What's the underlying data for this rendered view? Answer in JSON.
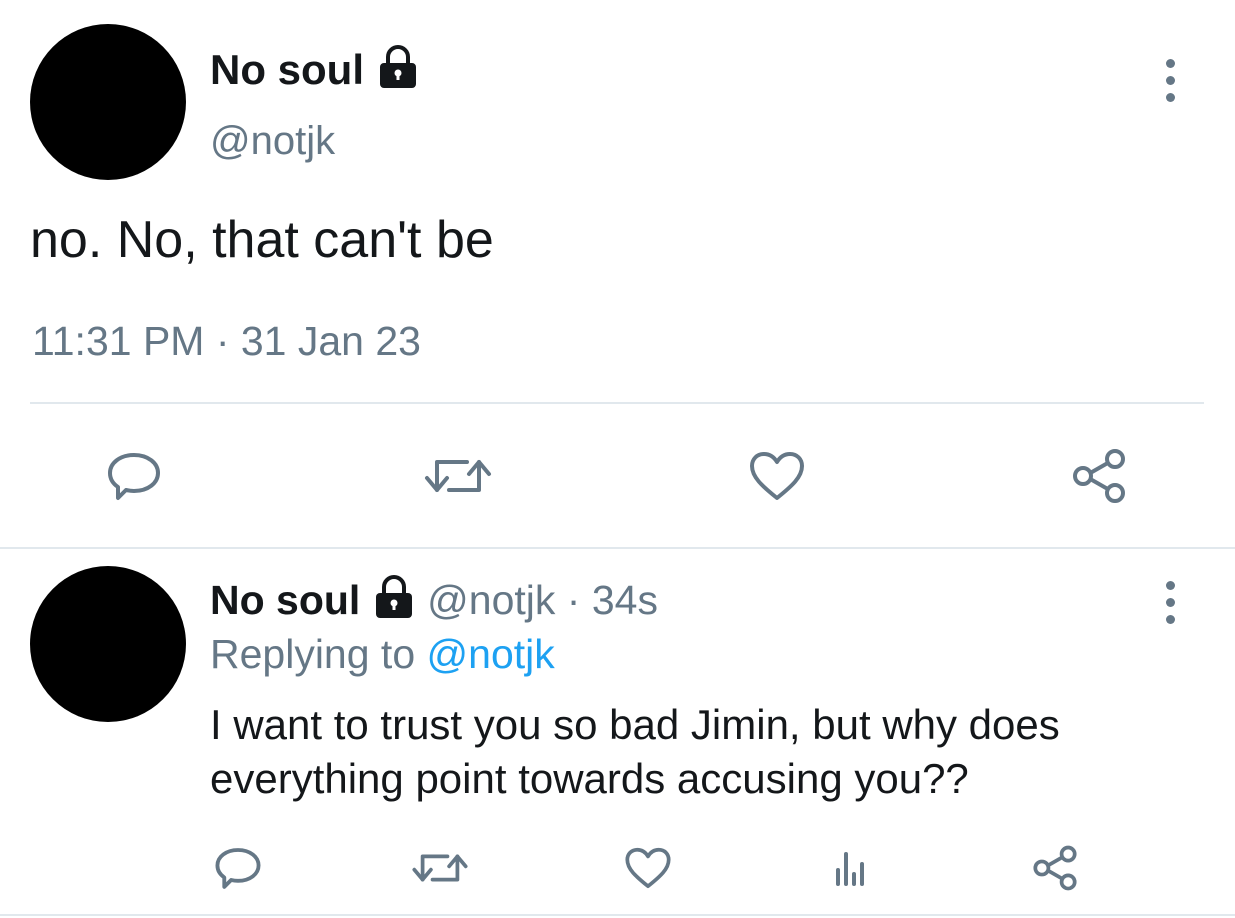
{
  "main_tweet": {
    "display_name": "No soul",
    "handle": "@notjk",
    "text": "no. No, that can't be",
    "timestamp": "11:31 PM · 31 Jan 23",
    "actions": [
      "reply-icon",
      "retweet-icon",
      "like-icon",
      "share-icon"
    ]
  },
  "reply_tweet": {
    "display_name": "No soul",
    "handle": "@notjk",
    "separator": "·",
    "age": "34s",
    "replying_prefix": "Replying to",
    "replying_handle": "@notjk",
    "text_line1": "I want to trust you so bad Jimin, but why does",
    "text_line2": "everything point towards accusing you??",
    "actions": [
      "reply-icon",
      "retweet-icon",
      "like-icon",
      "analytics-icon",
      "share-icon"
    ]
  },
  "colors": {
    "text": "#14171a",
    "muted": "#657786",
    "link": "#1da1f2",
    "divider": "#e1e8ed"
  }
}
